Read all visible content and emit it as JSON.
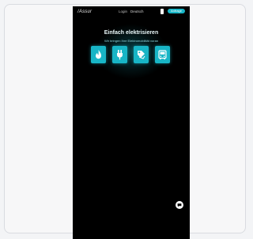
{
  "header": {
    "brand": "/Assur",
    "login": "Login",
    "language": "Deutsch",
    "cta_label": "Anfrage"
  },
  "hero": {
    "title": "Einfach elektrisieren",
    "subtitle": "Wir bringen Ihre Elektromobilität voran"
  },
  "icons": [
    "flame-icon",
    "plug-icon",
    "tag-icon",
    "bus-icon"
  ],
  "colors": {
    "accent": "#18b5c6",
    "background": "#000000"
  }
}
